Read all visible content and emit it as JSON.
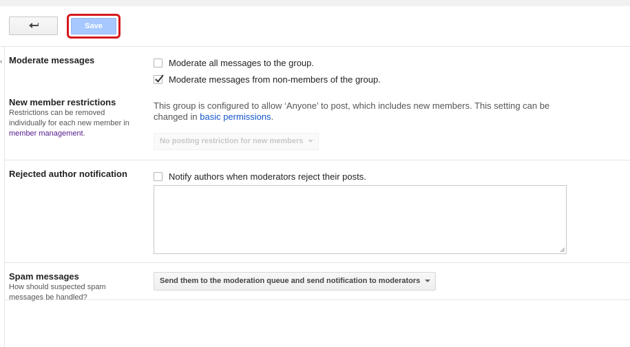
{
  "toolbar": {
    "back_icon": "back-arrow-icon",
    "save_label": "Save",
    "highlight_color": "#d5171b"
  },
  "moderate_messages": {
    "title": "Moderate messages",
    "options": [
      {
        "label": "Moderate all messages to the group.",
        "checked": false
      },
      {
        "label": "Moderate messages from non-members of the group.",
        "checked": true
      }
    ]
  },
  "new_member_restrictions": {
    "title": "New member restrictions",
    "desc_prefix": "Restrictions can be removed individually for each new member in ",
    "desc_link": "member management",
    "desc_suffix": ".",
    "info_text": "This group is configured to allow ‘Anyone’ to post, which includes new members. This setting can be changed in ",
    "info_link": "basic permissions",
    "info_suffix": ".",
    "select_value": "No posting restriction for new members"
  },
  "rejected_author_notification": {
    "title": "Rejected author notification",
    "checkbox_label": "Notify authors when moderators reject their posts.",
    "checked": false,
    "textarea_value": ""
  },
  "spam_messages": {
    "title": "Spam messages",
    "desc": "How should suspected spam messages be handled?",
    "select_value": "Send them to the moderation queue and send notification to moderators"
  }
}
